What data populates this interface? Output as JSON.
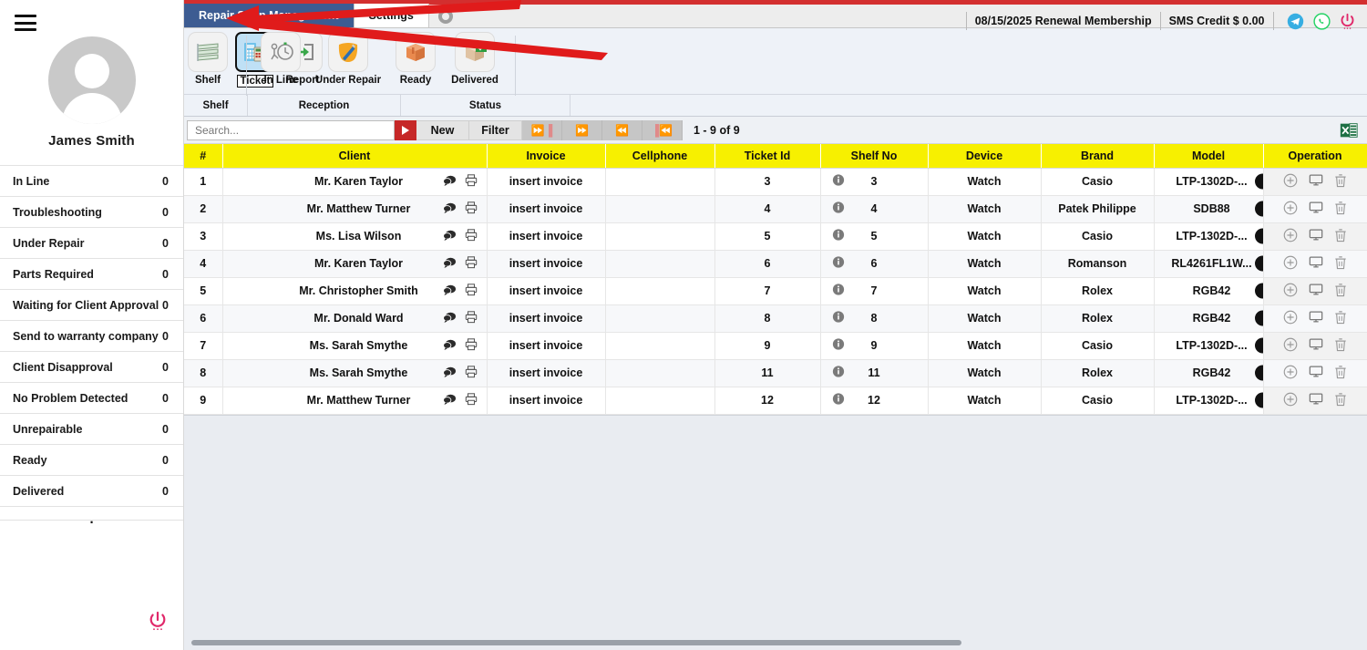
{
  "sidebar": {
    "menu_icon": "hamburger-icon",
    "avatar_icon": "user-avatar",
    "user_name": "James Smith",
    "dot": ".",
    "power_icon": "power-icon",
    "items": [
      {
        "label": "In Line",
        "count": "0"
      },
      {
        "label": "Troubleshooting",
        "count": "0"
      },
      {
        "label": "Under Repair",
        "count": "0"
      },
      {
        "label": "Parts Required",
        "count": "0"
      },
      {
        "label": "Waiting for Client Approval",
        "count": "0"
      },
      {
        "label": "Send to warranty company",
        "count": "0"
      },
      {
        "label": "Client Disapproval",
        "count": "0"
      },
      {
        "label": "No Problem Detected",
        "count": "0"
      },
      {
        "label": "Unrepairable",
        "count": "0"
      },
      {
        "label": "Ready",
        "count": "0"
      },
      {
        "label": "Delivered",
        "count": "0"
      }
    ]
  },
  "tabs": {
    "app_tab": "Repair Shop Management",
    "settings_tab": "Settings",
    "close_icon": "close-circle-icon"
  },
  "header": {
    "membership": "08/15/2025 Renewal Membership",
    "sms_credit": "SMS Credit $ 0.00",
    "telegram_icon": "telegram-icon",
    "whatsapp_icon": "whatsapp-icon",
    "power_icon": "power-icon"
  },
  "ribbon": {
    "buttons": [
      {
        "label": "Shelf",
        "icon": "shelf-icon",
        "selected": false
      },
      {
        "label": "Ticket",
        "icon": "ticket-icon",
        "selected": true
      },
      {
        "label": "Report",
        "icon": "report-icon",
        "selected": false
      },
      {
        "label": "In Line",
        "icon": "in-line-icon",
        "selected": false
      },
      {
        "label": "Under Repair",
        "icon": "under-repair-icon",
        "selected": false
      },
      {
        "label": "Ready",
        "icon": "ready-icon",
        "selected": false
      },
      {
        "label": "Delivered",
        "icon": "delivered-icon",
        "selected": false
      }
    ],
    "groups": [
      {
        "label": "Shelf"
      },
      {
        "label": "Reception"
      },
      {
        "label": "Status"
      }
    ]
  },
  "toolbar": {
    "search_placeholder": "Search...",
    "search_value": "",
    "search_go_icon": "play-icon",
    "new_label": "New",
    "filter_label": "Filter",
    "page_first_icon": "page-last-icon",
    "page_next_icon": "page-next-icon",
    "page_prev_icon": "page-prev-icon",
    "page_last_icon": "page-first-icon",
    "page_info": "1 - 9 of 9",
    "excel_icon": "excel-export-icon"
  },
  "table": {
    "columns": [
      "#",
      "Client",
      "Invoice",
      "Cellphone",
      "Ticket Id",
      "Shelf No",
      "Device",
      "Brand",
      "Model",
      "Operation"
    ],
    "row_icons": {
      "chat": "chat-icon",
      "print": "printer-icon",
      "info": "info-icon",
      "add": "plus-circle-icon",
      "monitor": "monitor-icon",
      "delete": "trash-icon"
    },
    "rows": [
      {
        "num": "1",
        "client": "Mr. Karen Taylor",
        "invoice": "insert invoice",
        "cellphone": "",
        "ticket": "3",
        "shelf": "3",
        "device": "Watch",
        "brand": "Casio",
        "model": "LTP-1302D-..."
      },
      {
        "num": "2",
        "client": "Mr. Matthew Turner",
        "invoice": "insert invoice",
        "cellphone": "",
        "ticket": "4",
        "shelf": "4",
        "device": "Watch",
        "brand": "Patek Philippe",
        "model": "SDB88"
      },
      {
        "num": "3",
        "client": "Ms. Lisa Wilson",
        "invoice": "insert invoice",
        "cellphone": "",
        "ticket": "5",
        "shelf": "5",
        "device": "Watch",
        "brand": "Casio",
        "model": "LTP-1302D-..."
      },
      {
        "num": "4",
        "client": "Mr. Karen Taylor",
        "invoice": "insert invoice",
        "cellphone": "",
        "ticket": "6",
        "shelf": "6",
        "device": "Watch",
        "brand": "Romanson",
        "model": "RL4261FL1W..."
      },
      {
        "num": "5",
        "client": "Mr. Christopher Smith",
        "invoice": "insert invoice",
        "cellphone": "",
        "ticket": "7",
        "shelf": "7",
        "device": "Watch",
        "brand": "Rolex",
        "model": "RGB42"
      },
      {
        "num": "6",
        "client": "Mr. Donald Ward",
        "invoice": "insert invoice",
        "cellphone": "",
        "ticket": "8",
        "shelf": "8",
        "device": "Watch",
        "brand": "Rolex",
        "model": "RGB42"
      },
      {
        "num": "7",
        "client": "Ms. Sarah Smythe",
        "invoice": "insert invoice",
        "cellphone": "",
        "ticket": "9",
        "shelf": "9",
        "device": "Watch",
        "brand": "Casio",
        "model": "LTP-1302D-..."
      },
      {
        "num": "8",
        "client": "Ms. Sarah Smythe",
        "invoice": "insert invoice",
        "cellphone": "",
        "ticket": "11",
        "shelf": "11",
        "device": "Watch",
        "brand": "Rolex",
        "model": "RGB42"
      },
      {
        "num": "9",
        "client": "Mr. Matthew Turner",
        "invoice": "insert invoice",
        "cellphone": "",
        "ticket": "12",
        "shelf": "12",
        "device": "Watch",
        "brand": "Casio",
        "model": "LTP-1302D-..."
      }
    ]
  },
  "annotation": {
    "arrow_color": "#e01b1b",
    "arrow_name": "red-pointer-arrow"
  },
  "colors": {
    "accent_red": "#d32f2f",
    "tab_blue": "#3d5c92",
    "header_yellow": "#f7f000"
  }
}
